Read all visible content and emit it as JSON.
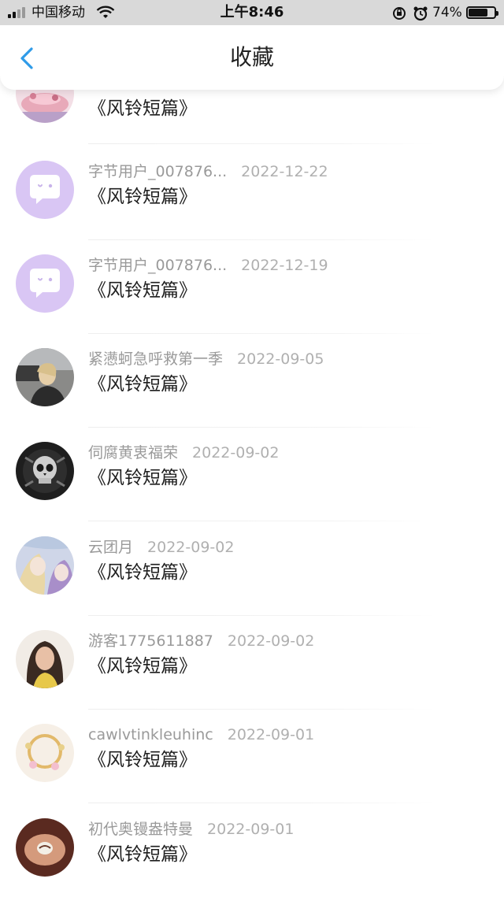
{
  "status_bar": {
    "carrier": "中国移动",
    "time": "上午8:46",
    "battery": "74%",
    "battery_level": 0.74
  },
  "header": {
    "title": "收藏"
  },
  "items": [
    {
      "user": "",
      "date": "",
      "title": "《风铃短篇》",
      "avatar": "photo-pink"
    },
    {
      "user": "字节用户_007876...",
      "date": "2022-12-22",
      "title": "《风铃短篇》",
      "avatar": "default-chat-bubble"
    },
    {
      "user": "字节用户_007876...",
      "date": "2022-12-19",
      "title": "《风铃短篇》",
      "avatar": "default-chat-bubble"
    },
    {
      "user": "紧懑蚵急呼救第一季",
      "date": "2022-09-05",
      "title": "《风铃短篇》",
      "avatar": "photo-street"
    },
    {
      "user": "伺腐黄衷福荣",
      "date": "2022-09-02",
      "title": "《风铃短篇》",
      "avatar": "photo-skull"
    },
    {
      "user": "云团月",
      "date": "2022-09-02",
      "title": "《风铃短篇》",
      "avatar": "photo-anime"
    },
    {
      "user": "游客1775611887",
      "date": "2022-09-02",
      "title": "《风铃短篇》",
      "avatar": "photo-portrait"
    },
    {
      "user": "cawlvtinkleuhinc",
      "date": "2022-09-01",
      "title": "《风铃短篇》",
      "avatar": "photo-bracelet"
    },
    {
      "user": "初代奥镘盎特曼",
      "date": "2022-09-01",
      "title": "《风铃短篇》",
      "avatar": "photo-hands"
    }
  ],
  "colors": {
    "accent": "#2f9be8",
    "default_avatar_bg": "#d9c6f4",
    "text_meta": "#9a9a9a",
    "text_title": "#1f1f1f"
  }
}
